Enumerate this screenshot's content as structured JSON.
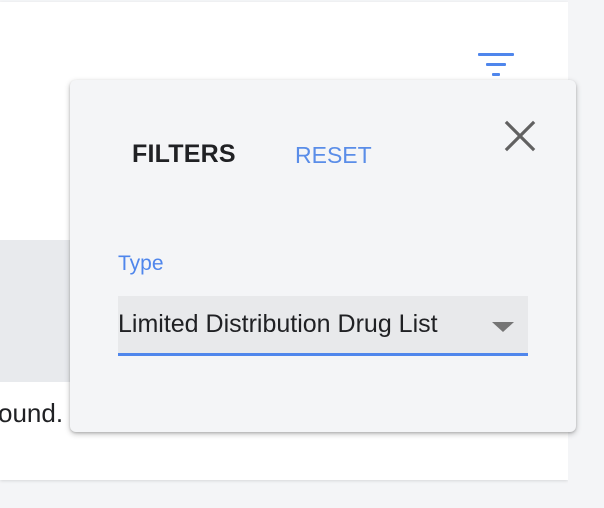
{
  "background": {
    "results_message": "ound."
  },
  "filter_toggle": {
    "icon": "filter-icon"
  },
  "filters_panel": {
    "title": "FILTERS",
    "reset_label": "RESET",
    "close_icon": "close-icon",
    "type_filter": {
      "label": "Type",
      "selected_value": "Limited Distribution Drug List",
      "dropdown_icon": "arrow-drop-down-icon"
    }
  },
  "colors": {
    "accent": "#4f86ec",
    "panel_background": "#f4f5f7",
    "select_background": "#e8e9eb",
    "text": "#202124"
  }
}
